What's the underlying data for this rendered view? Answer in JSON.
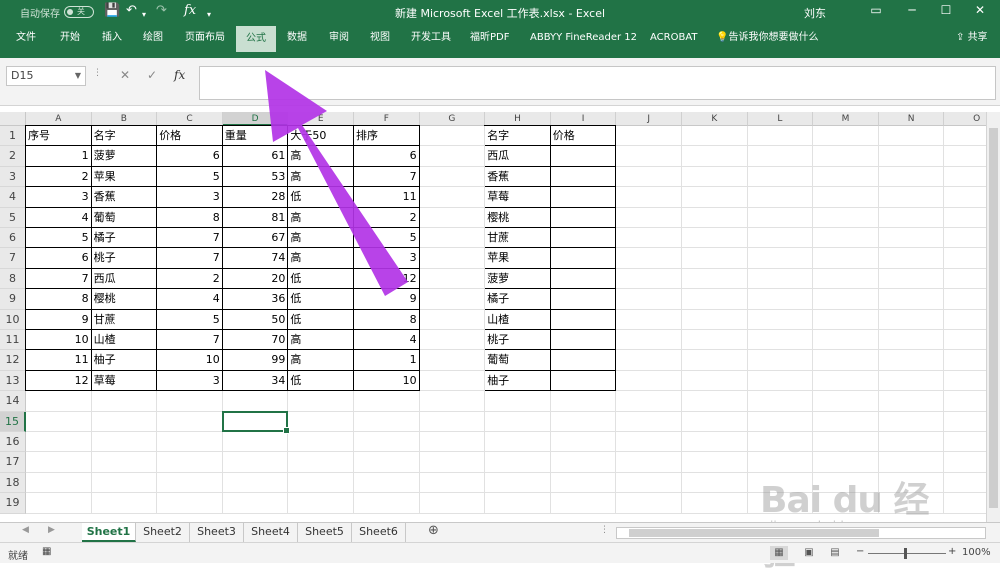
{
  "titlebar": {
    "autosave_label": "自动保存",
    "autosave_state": "关",
    "document_title": "新建 Microsoft Excel 工作表.xlsx  -  Excel",
    "user": "刘东",
    "save_icon": "save-icon",
    "undo_icon": "undo-icon",
    "redo_icon": "redo-icon",
    "fx_label": "fx"
  },
  "ribbon": {
    "tabs": [
      "文件",
      "开始",
      "插入",
      "绘图",
      "页面布局",
      "公式",
      "数据",
      "审阅",
      "视图",
      "开发工具",
      "福昕PDF",
      "ABBYY FineReader 12",
      "ACROBAT"
    ],
    "active_tab": "公式",
    "tell_me": "告诉我你想要做什么",
    "share": "共享"
  },
  "formula_bar": {
    "name_box": "D15",
    "cancel_icon": "✕",
    "enter_icon": "✓",
    "fx": "fx",
    "formula": ""
  },
  "columns": [
    "A",
    "B",
    "C",
    "D",
    "E",
    "F",
    "G",
    "H",
    "I",
    "J",
    "K",
    "L",
    "M",
    "N",
    "O"
  ],
  "rows": [
    "1",
    "2",
    "3",
    "4",
    "5",
    "6",
    "7",
    "8",
    "9",
    "10",
    "11",
    "12",
    "13",
    "14",
    "15",
    "16",
    "17",
    "18",
    "19"
  ],
  "selected_cell": "D15",
  "table1": {
    "headers": [
      "序号",
      "名字",
      "价格",
      "重量",
      "大于50",
      "排序"
    ],
    "rows": [
      [
        "1",
        "菠萝",
        "6",
        "61",
        "高",
        "6"
      ],
      [
        "2",
        "苹果",
        "5",
        "53",
        "高",
        "7"
      ],
      [
        "3",
        "香蕉",
        "3",
        "28",
        "低",
        "11"
      ],
      [
        "4",
        "葡萄",
        "8",
        "81",
        "高",
        "2"
      ],
      [
        "5",
        "橘子",
        "7",
        "67",
        "高",
        "5"
      ],
      [
        "6",
        "桃子",
        "7",
        "74",
        "高",
        "3"
      ],
      [
        "7",
        "西瓜",
        "2",
        "20",
        "低",
        "12"
      ],
      [
        "8",
        "樱桃",
        "4",
        "36",
        "低",
        "9"
      ],
      [
        "9",
        "甘蔗",
        "5",
        "50",
        "低",
        "8"
      ],
      [
        "10",
        "山楂",
        "7",
        "70",
        "高",
        "4"
      ],
      [
        "11",
        "柚子",
        "10",
        "99",
        "高",
        "1"
      ],
      [
        "12",
        "草莓",
        "3",
        "34",
        "低",
        "10"
      ]
    ]
  },
  "table2": {
    "headers": [
      "名字",
      "价格"
    ],
    "rows": [
      [
        "西瓜",
        ""
      ],
      [
        "香蕉",
        ""
      ],
      [
        "草莓",
        ""
      ],
      [
        "樱桃",
        ""
      ],
      [
        "甘蔗",
        ""
      ],
      [
        "苹果",
        ""
      ],
      [
        "菠萝",
        ""
      ],
      [
        "橘子",
        ""
      ],
      [
        "山楂",
        ""
      ],
      [
        "桃子",
        ""
      ],
      [
        "葡萄",
        ""
      ],
      [
        "柚子",
        ""
      ]
    ]
  },
  "sheets": [
    "Sheet1",
    "Sheet2",
    "Sheet3",
    "Sheet4",
    "Sheet5",
    "Sheet6"
  ],
  "active_sheet": "Sheet1",
  "status": {
    "ready": "就绪",
    "zoom": "100%"
  },
  "watermark": {
    "brand": "Bai du 经验",
    "url": "jingyan.baidu.com"
  },
  "annotation_arrow_color": "#b233e6",
  "accent": "#217346"
}
